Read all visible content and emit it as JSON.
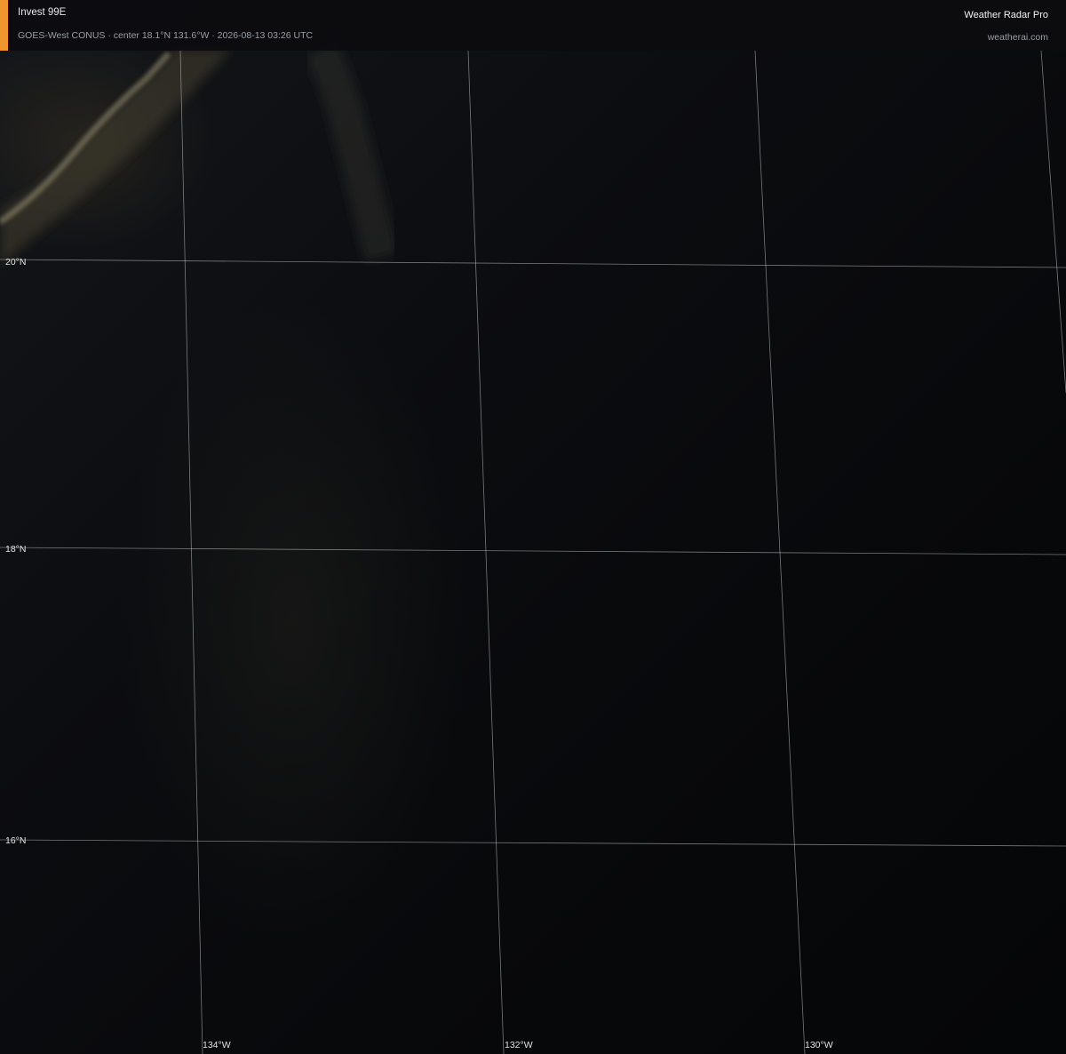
{
  "header": {
    "storm_name": "Invest 99E",
    "subtitle": "GOES-West CONUS · center 18.1°N 131.6°W · 2026-08-13 03:26 UTC",
    "brand": "Weather Radar Pro",
    "site": "weatherai.com",
    "accent_color": "#f0962f"
  },
  "map": {
    "latitude_labels": [
      "20°N",
      "18°N",
      "16°N"
    ],
    "longitude_labels": [
      "134°W",
      "132°W",
      "130°W"
    ]
  }
}
